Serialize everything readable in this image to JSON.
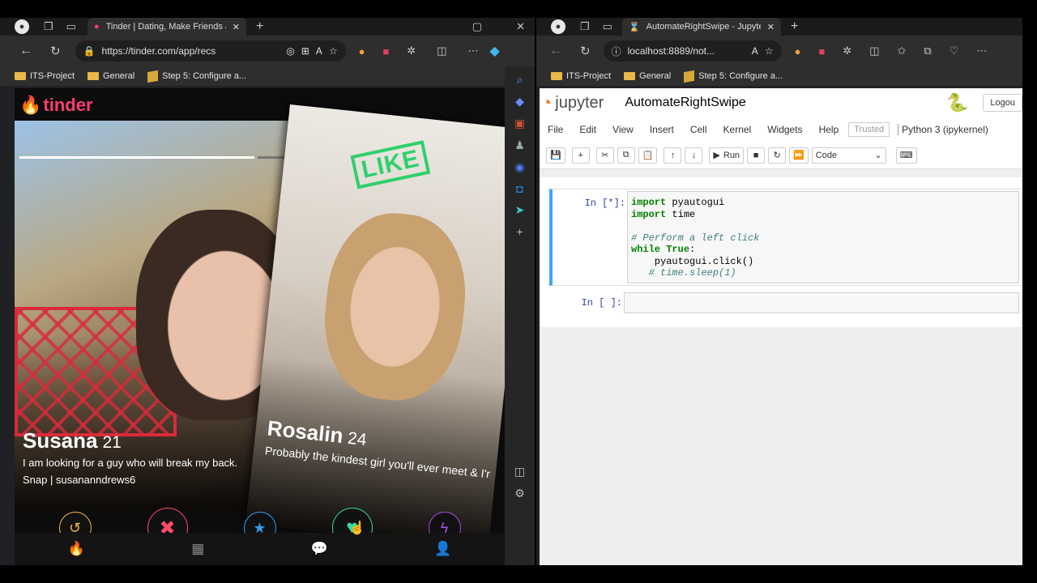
{
  "left_browser": {
    "tab_title": "Tinder | Dating, Make Friends & M",
    "url": "https://tinder.com/app/recs",
    "bookmarks": [
      "ITS-Project",
      "General",
      "Step 5: Configure a..."
    ]
  },
  "tinder": {
    "logo": "tinder",
    "stamp": "LIKE",
    "card1": {
      "name": "Susana",
      "age": "21",
      "bio_line1": "I am looking for a guy who will break my back.",
      "bio_line2": "Snap | susananndrews6"
    },
    "card2": {
      "name": "Rosalin",
      "age": "24",
      "bio": "Probably the kindest girl you'll ever meet & I'r"
    },
    "buttons": [
      {
        "icon": "rewind-icon",
        "color": "#f5b748"
      },
      {
        "icon": "nope-icon",
        "color": "#fe4a6b"
      },
      {
        "icon": "super-like-icon",
        "color": "#2f9cf2"
      },
      {
        "icon": "like-icon",
        "color": "#33e0a3"
      },
      {
        "icon": "boost-icon",
        "color": "#a74ce8"
      }
    ]
  },
  "right_browser": {
    "tab_title": "AutomateRightSwipe - Jupyter N",
    "url": "localhost:8889/not...",
    "bookmarks": [
      "ITS-Project",
      "General",
      "Step 5: Configure a..."
    ]
  },
  "jupyter": {
    "brand": "jupyter",
    "notebook_name": "AutomateRightSwipe",
    "logout": "Logou",
    "menu": [
      "File",
      "Edit",
      "View",
      "Insert",
      "Cell",
      "Kernel",
      "Widgets",
      "Help"
    ],
    "trusted": "Trusted",
    "kernel": "Python 3 (ipykernel)",
    "run_label": "Run",
    "cell_type": "Code",
    "cell1_prompt": "In [*]:",
    "cell2_prompt": "In [ ]:",
    "code_lines": [
      "import pyautogui",
      "import time",
      "",
      "# Perform a left click",
      "while True:",
      "    pyautogui.click()",
      "   # time.sleep(1)"
    ]
  }
}
